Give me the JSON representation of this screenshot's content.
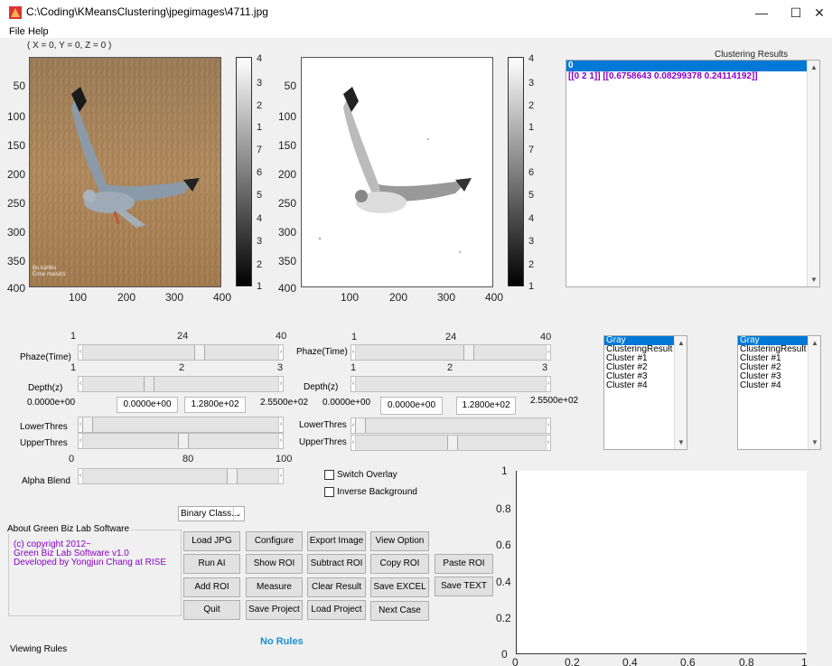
{
  "window": {
    "title": "C:\\Coding\\KMeansClustering\\jpegimages\\4711.jpg",
    "minimize": "—",
    "maximize": "☐",
    "close": "✕"
  },
  "menu": {
    "file": "File",
    "help": "Help"
  },
  "coords": "( X = 0, Y = 0, Z = 0 )",
  "image_axes": {
    "yticks": [
      "50",
      "100",
      "150",
      "200",
      "250",
      "300",
      "350",
      "400"
    ],
    "xticks": [
      "100",
      "200",
      "300",
      "400"
    ],
    "cbar_left": [
      "4",
      "3",
      "2",
      "1",
      "7",
      "6",
      "5",
      "4",
      "3",
      "2",
      "1"
    ],
    "cbar_right": [
      "4",
      "3",
      "2",
      "1",
      "7",
      "6",
      "5",
      "4",
      "3",
      "2",
      "1"
    ],
    "watermark": "Bu kārtiks\nĒrme maisiņš"
  },
  "results": {
    "title": "Clustering Results",
    "line0": "0",
    "line1": "[[0 2 1]] [[0.6758643  0.08299378 0.24114192]]"
  },
  "left_controls": {
    "phaze_ticks": [
      "1",
      "24",
      "40"
    ],
    "phaze_label": "Phaze(Time)",
    "depth_ticks": [
      "1",
      "2",
      "3"
    ],
    "depth_label": "Depth(z)",
    "range_min": "0.0000e+00",
    "edit1": "0.0000e+00",
    "edit2": "1.2800e+02",
    "range_max": "2.5500e+02",
    "lower": "LowerThres",
    "upper": "UpperThres",
    "alpha_ticks": [
      "0",
      "80",
      "100"
    ],
    "alpha_label": "Alpha Blend"
  },
  "right_controls": {
    "phaze_ticks": [
      "1",
      "24",
      "40"
    ],
    "phaze_label": "Phaze(Time)",
    "depth_ticks": [
      "1",
      "2",
      "3"
    ],
    "depth_label": "Depth(z)",
    "range_min": "0.0000e+00",
    "edit1": "0.0000e+00",
    "edit2": "1.2800e+02",
    "range_max": "2.5500e+02",
    "lower": "LowerThres",
    "upper": "UpperThres"
  },
  "listbox_items": [
    "Gray",
    "ClusteringResult",
    "Cluster #1",
    "Cluster #2",
    "Cluster #3",
    "Cluster #4"
  ],
  "switch_overlay": "Switch Overlay",
  "inverse_bg": "Inverse Background",
  "binary_select": "Binary Class...",
  "about": {
    "title": "About Green Biz Lab Software",
    "l1": "(c) copyright 2012~",
    "l2": "Green Biz Lab Software v1.0",
    "l3": "Developed by Yongjun Chang at RISE"
  },
  "buttons": {
    "load_jpg": "Load JPG File",
    "configure": "Configure",
    "export_image": "Export Image",
    "view_option": "View Option",
    "run_ai": "Run AI",
    "show_roi": "Show ROI",
    "subtract_roi": "Subtract ROI",
    "copy_roi": "Copy ROI",
    "paste_roi": "Paste ROI",
    "add_roi": "Add ROI",
    "measure": "Measure",
    "clear_result": "Clear Result",
    "save_excel": "Save EXCEL",
    "save_text": "Save TEXT",
    "quit": "Quit",
    "save_project": "Save Project",
    "load_project": "Load Project",
    "next_case": "Next Case"
  },
  "viewing_rules": "Viewing Rules",
  "no_rules": "No Rules",
  "plot": {
    "yticks": [
      "1",
      "0.8",
      "0.6",
      "0.4",
      "0.2",
      "0"
    ],
    "xticks": [
      "0",
      "0.2",
      "0.4",
      "0.6",
      "0.8",
      "1"
    ]
  },
  "colors": {
    "selection": "#0078d7",
    "results_text": "#8a00c8",
    "about_text": "#8a00c8",
    "no_rules": "#1a8fd0"
  }
}
